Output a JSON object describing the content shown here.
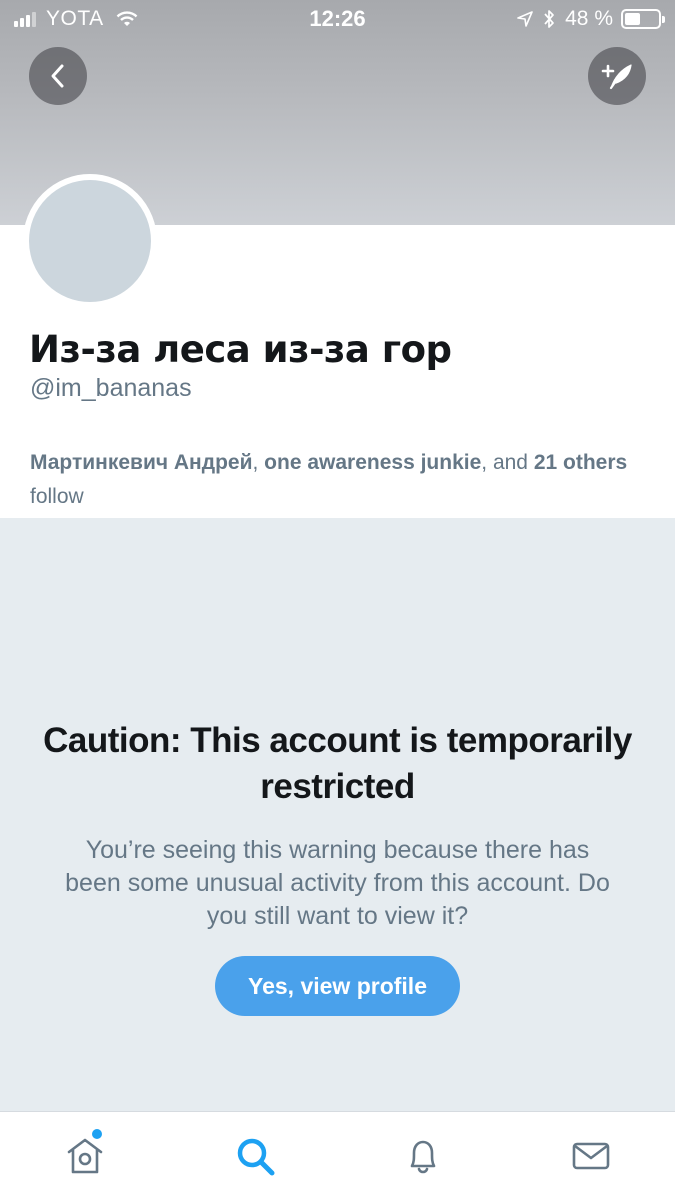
{
  "status_bar": {
    "carrier": "YOTA",
    "time": "12:26",
    "battery_percent_label": "48 %",
    "battery_level": 0.48,
    "icons": [
      "signal-icon",
      "wifi-icon",
      "location-arrow-icon",
      "bluetooth-icon",
      "battery-icon"
    ]
  },
  "header": {
    "back_icon": "chevron-left-icon",
    "compose_icon": "compose-tweet-icon"
  },
  "profile": {
    "name": "Из-за леса из-за гор",
    "handle": "@im_bananas",
    "followers": {
      "name1": "Мартинкевич Андрей",
      "sep1": ", ",
      "name2": "one awareness junkie",
      "sep2": ", and ",
      "count": "21 others",
      "suffix": " follow"
    }
  },
  "caution": {
    "title": "Caution: This account is temporarily restricted",
    "body": "You’re seeing this warning because there has been some unusual activity from this account. Do you still want to view it?",
    "button_label": "Yes, view profile"
  },
  "tab_bar": {
    "tabs": [
      "home-icon",
      "search-icon",
      "notifications-icon",
      "messages-icon"
    ],
    "active": "search-icon"
  },
  "colors": {
    "accent": "#1da1f2",
    "button": "#4aa1eb",
    "caution_bg": "#e6ecf0",
    "secondary_text": "#657786",
    "primary_text": "#14171a"
  }
}
